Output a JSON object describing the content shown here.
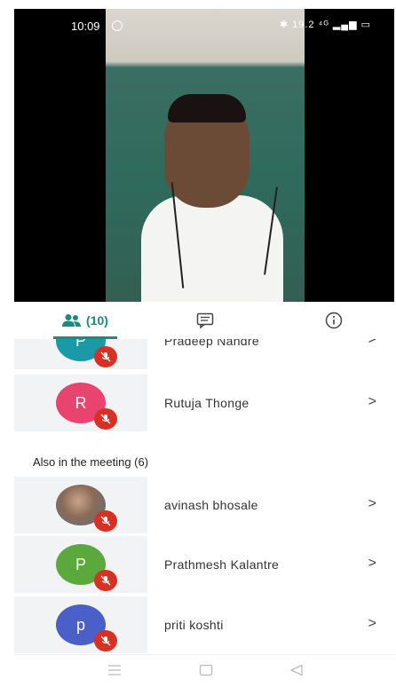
{
  "status": {
    "time": "10:09",
    "icons": "✱ 19.2 ⁴ᴳ ▂▄▆ ▭"
  },
  "tabs": {
    "people_count": "(10)"
  },
  "participants_top": [
    {
      "initial": "P",
      "name": "Pradeep Nandre",
      "color": "#1a9aa7"
    },
    {
      "initial": "R",
      "name": "Rutuja Thonge",
      "color": "#e8446f"
    }
  ],
  "also_label": "Also in the meeting (6)",
  "participants_also": [
    {
      "initial": "",
      "name": "avinash bhosale",
      "color": "#8a6a55"
    },
    {
      "initial": "P",
      "name": "Prathmesh Kalantre",
      "color": "#5ba83d"
    },
    {
      "initial": "p",
      "name": "priti koshti",
      "color": "#4b5fc8"
    }
  ],
  "chevron": ">",
  "colors": {
    "accent": "#1a8b7d",
    "muted": "#d93025"
  }
}
